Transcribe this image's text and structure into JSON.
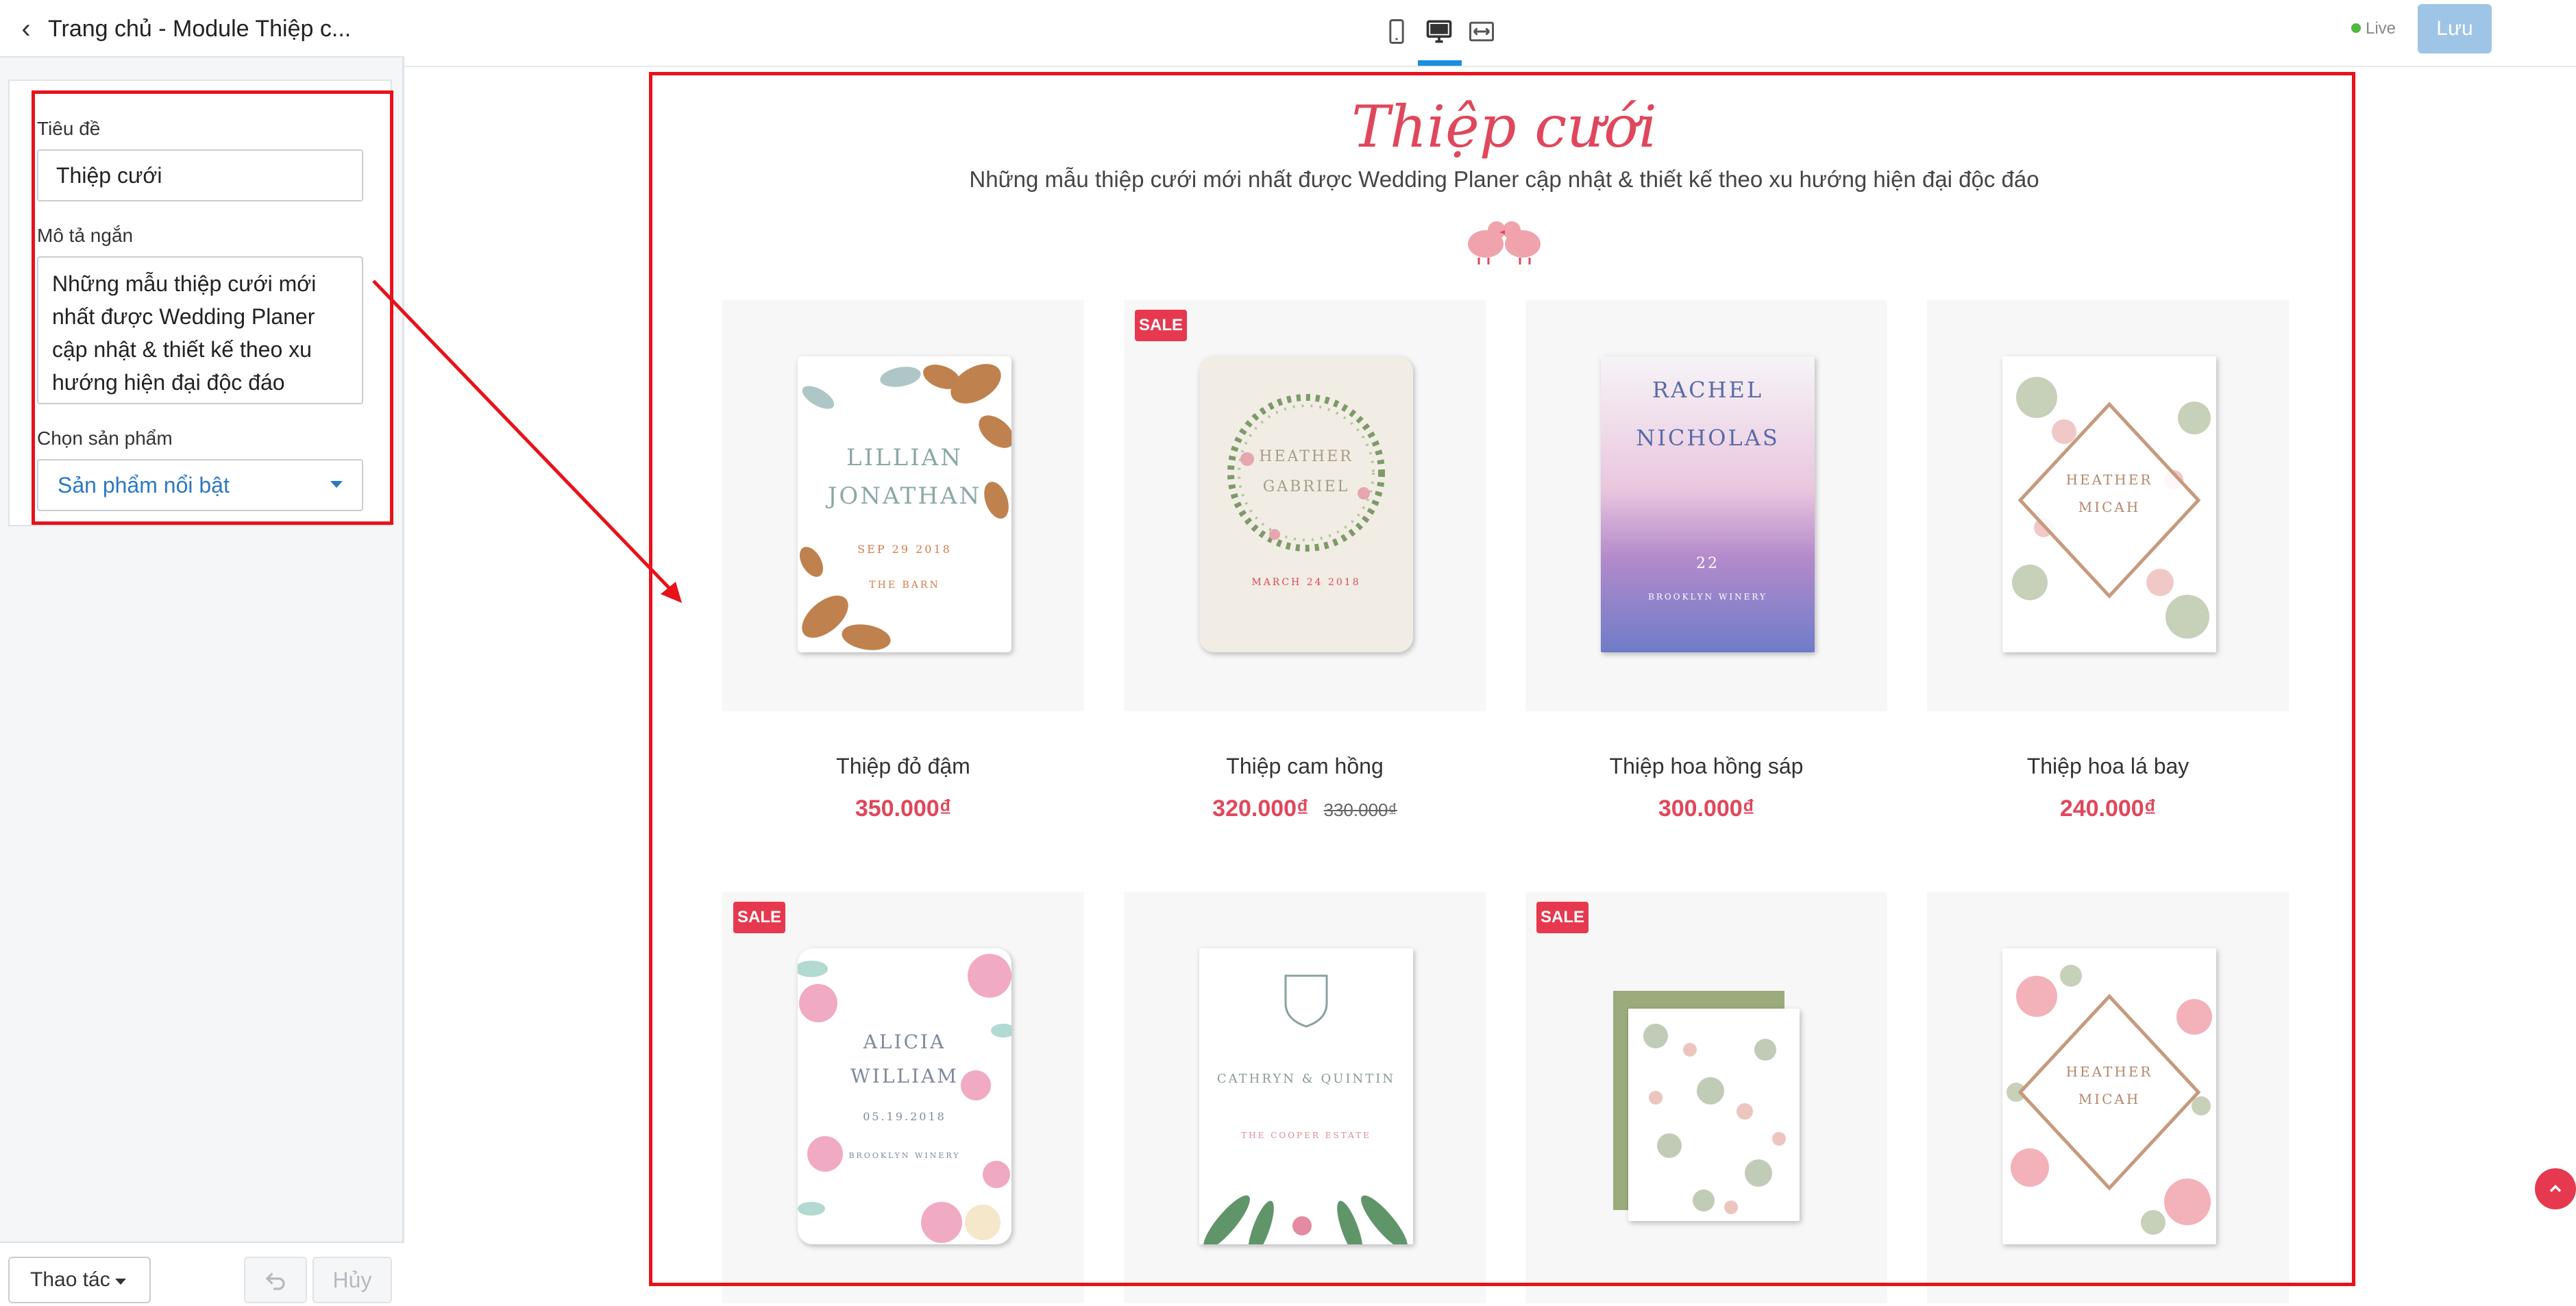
{
  "sidebar": {
    "title": "Trang chủ - Module Thiệp c...",
    "fields": {
      "title_label": "Tiêu đề",
      "title_value": "Thiệp cưới",
      "desc_label": "Mô tả ngắn",
      "desc_value": "Những mẫu thiệp cưới mới nhất được Wedding Planer cập nhật & thiết kế theo xu hướng hiện đại độc đáo",
      "product_label": "Chọn sản phẩm",
      "product_value": "Sản phẩm nổi bật"
    },
    "footer": {
      "action_label": "Thao tác",
      "undo_icon": "undo-icon",
      "cancel_label": "Hủy"
    }
  },
  "topbar": {
    "device_icons": [
      "mobile-icon",
      "desktop-icon",
      "fullwidth-icon"
    ],
    "active_device": "desktop",
    "live_label": "Live",
    "save_label": "Lưu"
  },
  "preview": {
    "section_title": "Thiệp cưới",
    "section_desc": "Những mẫu thiệp cưới mới nhất được Wedding Planer cập nhật & thiết kế theo xu hướng hiện đại độc đáo",
    "sale_label": "SALE",
    "products": [
      {
        "name": "Thiệp đỏ đậm",
        "price": "350.000₫",
        "old_price": "",
        "sale": false,
        "invite": {
          "names": [
            "LILLIAN",
            "JONATHAN"
          ],
          "date": "SEP 29 2018",
          "venue": "THE BARN"
        }
      },
      {
        "name": "Thiệp cam hồng",
        "price": "320.000₫",
        "old_price": "330.000₫",
        "sale": true,
        "invite": {
          "names": [
            "HEATHER",
            "GABRIEL"
          ],
          "date": "MARCH 24 2018",
          "venue": ""
        }
      },
      {
        "name": "Thiệp hoa hồng sáp",
        "price": "300.000₫",
        "old_price": "",
        "sale": false,
        "invite": {
          "names": [
            "RACHEL",
            "NICHOLAS"
          ],
          "date": "22",
          "venue": "BROOKLYN WINERY"
        }
      },
      {
        "name": "Thiệp hoa lá bay",
        "price": "240.000₫",
        "old_price": "",
        "sale": false,
        "invite": {
          "names": [
            "HEATHER",
            "MICAH"
          ],
          "date": "",
          "venue": ""
        }
      },
      {
        "name": "",
        "price": "",
        "old_price": "",
        "sale": true,
        "invite": {
          "names": [
            "ALICIA",
            "WILLIAM"
          ],
          "date": "05.19.2018",
          "venue": "BROOKLYN WINERY"
        }
      },
      {
        "name": "",
        "price": "",
        "old_price": "",
        "sale": false,
        "invite": {
          "names": [
            "CATHRYN & QUINTIN"
          ],
          "date": "",
          "venue": "THE COOPER ESTATE"
        }
      },
      {
        "name": "",
        "price": "",
        "old_price": "",
        "sale": true,
        "invite": {
          "names": [],
          "date": "",
          "venue": ""
        }
      },
      {
        "name": "",
        "price": "",
        "old_price": "",
        "sale": false,
        "invite": {
          "names": [
            "HEATHER",
            "MICAH"
          ],
          "date": "",
          "venue": ""
        }
      }
    ]
  },
  "colors": {
    "accent_red": "#e0475c",
    "sale_badge": "#e6384f",
    "link_blue": "#2b78c5",
    "save_button": "#9ec4e6",
    "annotation_red": "#e8121a",
    "live_green": "#50b83c"
  }
}
